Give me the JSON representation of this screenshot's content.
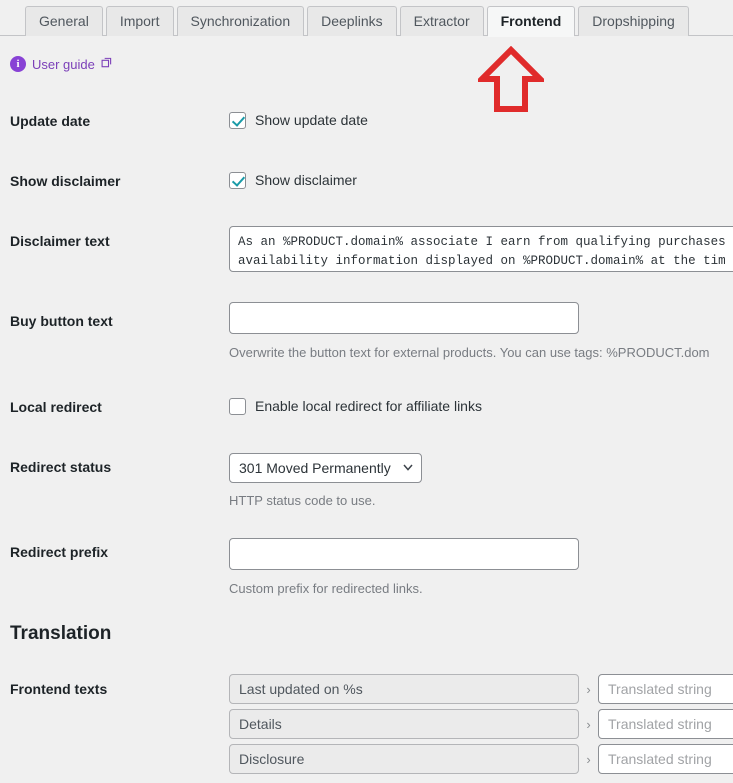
{
  "tabs": [
    {
      "label": "General",
      "active": false
    },
    {
      "label": "Import",
      "active": false
    },
    {
      "label": "Synchronization",
      "active": false
    },
    {
      "label": "Deeplinks",
      "active": false
    },
    {
      "label": "Extractor",
      "active": false
    },
    {
      "label": "Frontend",
      "active": true
    },
    {
      "label": "Dropshipping",
      "active": false
    }
  ],
  "user_guide": {
    "label": "User guide",
    "info_icon": "info-circle-icon",
    "external_icon": "external-link-icon",
    "color": "#7b3fb8"
  },
  "annotation": {
    "type": "up-arrow",
    "color": "#e02b2b",
    "points_at": "Frontend"
  },
  "fields": {
    "update_date": {
      "label": "Update date",
      "checkbox_label": "Show update date",
      "checked": true
    },
    "show_disclaimer": {
      "label": "Show disclaimer",
      "checkbox_label": "Show disclaimer",
      "checked": true
    },
    "disclaimer_text": {
      "label": "Disclaimer text",
      "value": "As an %PRODUCT.domain% associate I earn from qualifying purchases\navailability information displayed on %PRODUCT.domain% at the tim"
    },
    "buy_button_text": {
      "label": "Buy button text",
      "value": "",
      "helper": "Overwrite the button text for external products. You can use tags: %PRODUCT.dom"
    },
    "local_redirect": {
      "label": "Local redirect",
      "checkbox_label": "Enable local redirect for affiliate links",
      "checked": false
    },
    "redirect_status": {
      "label": "Redirect status",
      "selected": "301 Moved Permanently",
      "options": [
        "301 Moved Permanently"
      ],
      "helper": "HTTP status code to use."
    },
    "redirect_prefix": {
      "label": "Redirect prefix",
      "value": "",
      "helper": "Custom prefix for redirected links."
    }
  },
  "translation": {
    "heading": "Translation",
    "label": "Frontend texts",
    "separator": "›",
    "placeholder": "Translated string",
    "rows": [
      {
        "source": "Last updated on %s",
        "translated": ""
      },
      {
        "source": "Details",
        "translated": ""
      },
      {
        "source": "Disclosure",
        "translated": ""
      }
    ]
  },
  "colors": {
    "background": "#f0f0f0",
    "checkbox_check": "#1a9ba8",
    "accent_purple": "#8842d5",
    "annotation_red": "#e02b2b"
  }
}
